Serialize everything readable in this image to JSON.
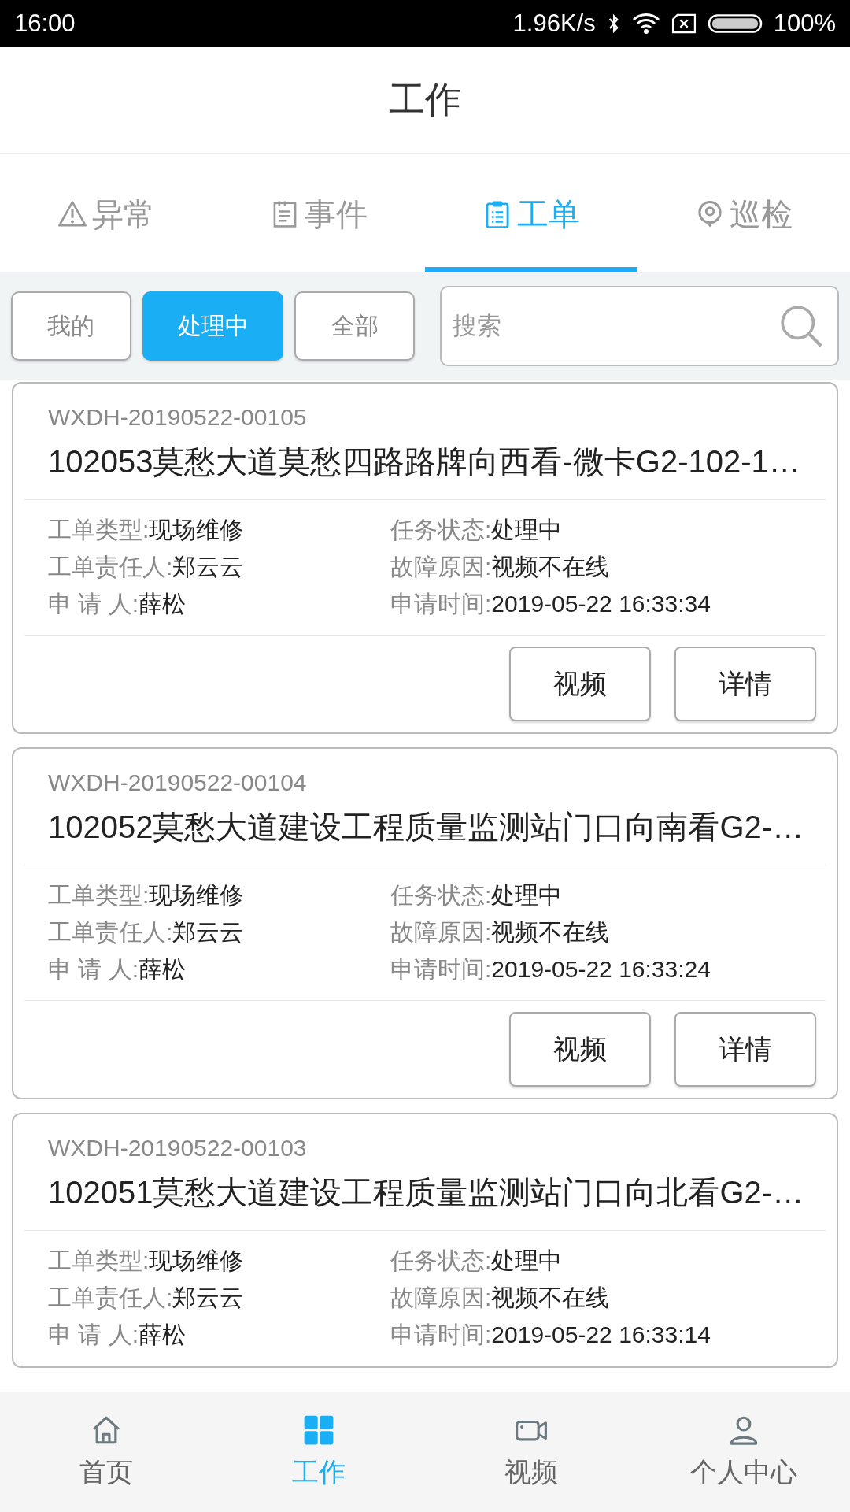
{
  "status_bar": {
    "time": "16:00",
    "speed": "1.96K/s",
    "battery": "100%"
  },
  "header": {
    "title": "工作"
  },
  "tabs": [
    {
      "label": "异常",
      "kind": "warning",
      "selected": false
    },
    {
      "label": "事件",
      "kind": "document",
      "selected": false
    },
    {
      "label": "工单",
      "kind": "clipboard",
      "selected": true
    },
    {
      "label": "巡检",
      "kind": "pin",
      "selected": false
    }
  ],
  "filters": [
    {
      "label": "我的",
      "selected": false
    },
    {
      "label": "处理中",
      "selected": true
    },
    {
      "label": "全部",
      "selected": false
    }
  ],
  "search": {
    "placeholder": "搜索"
  },
  "orders": [
    {
      "id": "WXDH-20190522-00105",
      "title": "102053莫愁大道莫愁四路路牌向西看-微卡G2-102-1…",
      "fields": [
        {
          "label": "工单类型:",
          "value": "现场维修"
        },
        {
          "label": "任务状态:",
          "value": "处理中"
        },
        {
          "label": "工单责任人:",
          "value": "郑云云"
        },
        {
          "label": "故障原因:",
          "value": "视频不在线"
        },
        {
          "label": "申 请 人:",
          "value": "薛松"
        },
        {
          "label": "申请时间:",
          "value": "2019-05-22 16:33:34"
        }
      ],
      "buttons": [
        "视频",
        "详情"
      ]
    },
    {
      "id": "WXDH-20190522-00104",
      "title": "102052莫愁大道建设工程质量监测站门口向南看G2-…",
      "fields": [
        {
          "label": "工单类型:",
          "value": "现场维修"
        },
        {
          "label": "任务状态:",
          "value": "处理中"
        },
        {
          "label": "工单责任人:",
          "value": "郑云云"
        },
        {
          "label": "故障原因:",
          "value": "视频不在线"
        },
        {
          "label": "申 请 人:",
          "value": "薛松"
        },
        {
          "label": "申请时间:",
          "value": "2019-05-22 16:33:24"
        }
      ],
      "buttons": [
        "视频",
        "详情"
      ]
    },
    {
      "id": "WXDH-20190522-00103",
      "title": "102051莫愁大道建设工程质量监测站门口向北看G2-…",
      "fields": [
        {
          "label": "工单类型:",
          "value": "现场维修"
        },
        {
          "label": "任务状态:",
          "value": "处理中"
        },
        {
          "label": "工单责任人:",
          "value": "郑云云"
        },
        {
          "label": "故障原因:",
          "value": "视频不在线"
        },
        {
          "label": "申 请 人:",
          "value": "薛松"
        },
        {
          "label": "申请时间:",
          "value": "2019-05-22 16:33:14"
        }
      ]
    }
  ],
  "bottom_nav": [
    {
      "label": "首页",
      "kind": "home",
      "selected": false
    },
    {
      "label": "工作",
      "kind": "grid",
      "selected": true
    },
    {
      "label": "视频",
      "kind": "camera",
      "selected": false
    },
    {
      "label": "个人中心",
      "kind": "person",
      "selected": false
    }
  ]
}
